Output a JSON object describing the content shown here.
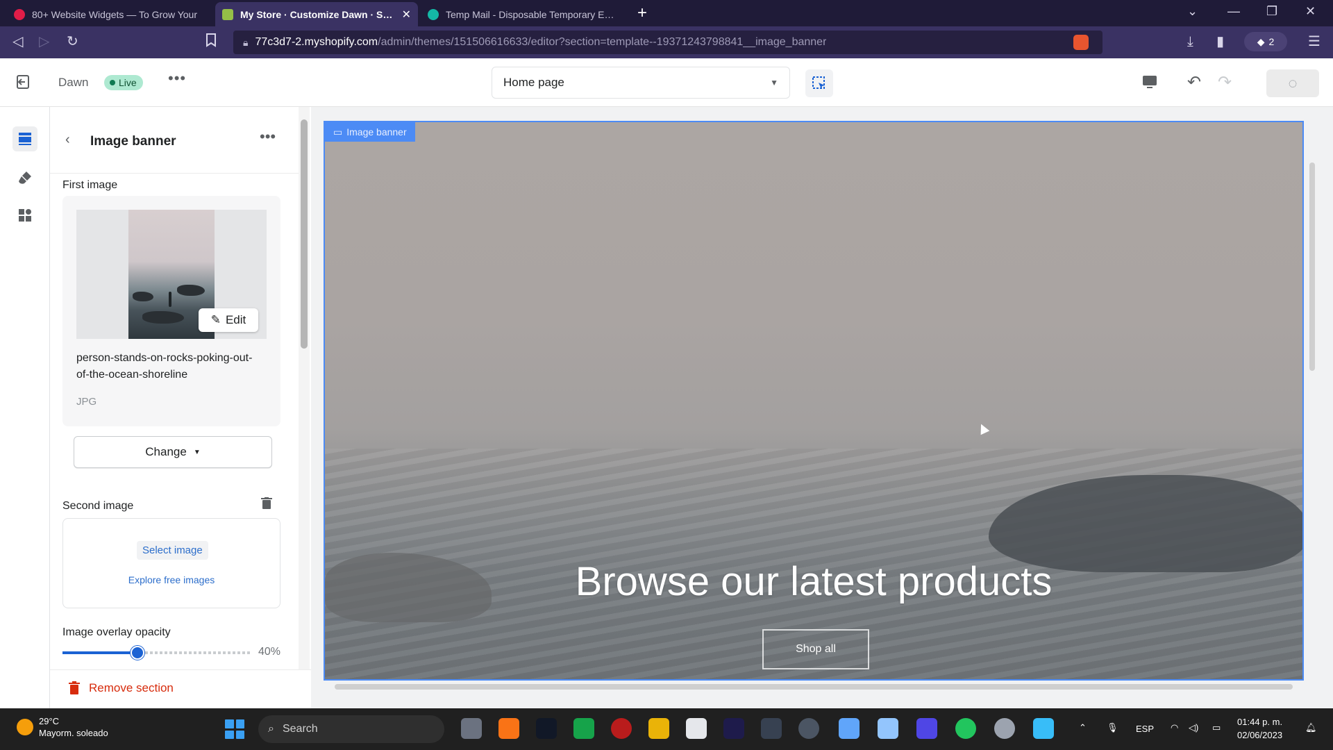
{
  "browser": {
    "tabs": [
      {
        "title": "80+ Website Widgets — To Grow Your",
        "active": false
      },
      {
        "title": "My Store · Customize Dawn · Shopify",
        "active": true
      },
      {
        "title": "Temp Mail - Disposable Temporary Email",
        "active": false
      }
    ],
    "url_host": "77c3d7-2.myshopify.com",
    "url_path": "/admin/themes/151506616633/editor?section=template--19371243798841__image_banner",
    "extension_count": "2"
  },
  "editor_header": {
    "theme_name": "Dawn",
    "live_badge": "Live",
    "page_select": "Home page"
  },
  "panel": {
    "title": "Image banner",
    "first_image": {
      "label": "First image",
      "edit_label": "Edit",
      "file_name": "person-stands-on-rocks-poking-out-of-the-ocean-shoreline",
      "file_type": "JPG",
      "change_label": "Change"
    },
    "second_image": {
      "label": "Second image",
      "select_label": "Select image",
      "explore_label": "Explore free images"
    },
    "overlay": {
      "label": "Image overlay opacity",
      "value": 40,
      "value_text": "40%"
    },
    "remove_label": "Remove section"
  },
  "preview": {
    "section_tag": "Image banner",
    "heading": "Browse our latest products",
    "button_label": "Shop all"
  },
  "taskbar": {
    "temperature": "29°C",
    "weather_text": "Mayorm. soleado",
    "search_label": "Search",
    "language": "ESP",
    "time": "01:44 p. m.",
    "date": "02/06/2023"
  },
  "colors": {
    "accent": "#4c8bf5",
    "slider": "#1b62d3",
    "danger": "#d72c0d",
    "live_badge_bg": "#aee9d1"
  }
}
